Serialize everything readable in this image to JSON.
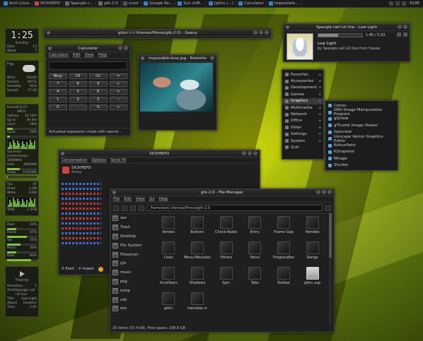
{
  "taskbar": {
    "items": [
      {
        "label": "Arch Linux",
        "color": "#3c7fc2"
      },
      {
        "label": "SICKHEPO",
        "color": "#c04545"
      },
      {
        "label": "Spangle c...",
        "color": "#6a6a6a"
      },
      {
        "label": "gtk-2.0",
        "color": "#6a6a6a"
      },
      {
        "label": "urxvt",
        "color": "#555"
      },
      {
        "label": "Google Re...",
        "color": "#3c7fc2"
      },
      {
        "label": "Sun xVB...",
        "color": "#3c7fc2"
      },
      {
        "label": "[gtkrc (...)",
        "color": "#3c7fc2"
      },
      {
        "label": "Calculator",
        "color": "#3c7fc2"
      },
      {
        "label": "impossible...",
        "color": "#3c7fc2"
      }
    ],
    "clock": "0135"
  },
  "sidebar": {
    "clock": {
      "time": "1:25",
      "day": "Sunday"
    },
    "date_rows": [
      [
        "Date",
        "13"
      ],
      [
        "Week",
        "7"
      ]
    ],
    "weather": {
      "label": "Fog",
      "rows": [
        [
          "Wind",
          "5km/h"
        ],
        [
          "Sunrise",
          "06:51"
        ],
        [
          "Humidity",
          "92%"
        ],
        [
          "Sunset",
          "17:43"
        ]
      ]
    },
    "system": {
      "rows": [
        [
          "Kernel",
          "2.6.27-ARCH"
        ],
        [
          "Uptime",
          "1h 10m"
        ],
        [
          "Up to",
          "0h 0m"
        ]
      ],
      "cpu1_label": "Cpu1",
      "cpu1_value": "18%",
      "cpu1_fill": 0.18,
      "cpu2_label": "Cpu2",
      "cpu2_value": "10%",
      "cpu2_fill": 0.1,
      "governor_label": "Governor",
      "governor_value": "performance 1600MHz",
      "ram_label": "Ram",
      "ram_value": "400/960",
      "ram_fill": 0.42,
      "swap_label": "Swap",
      "swap_value": "1%/1486",
      "swap_fill": 0.01
    },
    "disk": {
      "rows": [
        [
          "Tps",
          "47"
        ],
        [
          "Read",
          "1.2M"
        ],
        [
          "Write",
          "0.6M"
        ]
      ],
      "total_label": "Total",
      "total_value": "1.2GB"
    },
    "storage": {
      "rows": [
        [
          "Root",
          "32%"
        ],
        [
          "Home",
          "67%"
        ],
        [
          "Var",
          "45%"
        ],
        [
          "Music",
          "30%"
        ],
        [
          "Data",
          "80%"
        ]
      ],
      "fills": [
        0.32,
        0.67,
        0.45,
        0.3,
        0.8
      ]
    },
    "player_widget": {
      "status": "Playing",
      "rows": [
        [
          "Kainotoxa",
          "1"
        ],
        [
          "Artist",
          "Spangle call Lili line"
        ],
        [
          "Title",
          "Low Light"
        ],
        [
          "Album",
          "Isolation"
        ],
        [
          "Time",
          "1:45"
        ]
      ]
    }
  },
  "calculator": {
    "title": "Calculator",
    "menu": [
      "Calculator",
      "Edit",
      "View",
      "Help"
    ],
    "display": "",
    "keys": [
      "Bksp",
      "CE",
      "Clr",
      "=",
      "7",
      "8",
      "9",
      "÷",
      "4",
      "5",
      "6",
      "×",
      "1",
      "2",
      "3",
      "−",
      "0",
      ".",
      "%",
      "+"
    ],
    "status": "Activated expression mode with operat..."
  },
  "image_viewer": {
    "title": "impossible-love.jpg - Ristretto"
  },
  "editor_window": {
    "title": "gtkrc (~/.themes/Pirevo/gtk-2.0) - Geany"
  },
  "player": {
    "title": "Spangle call Lili line - Low Light",
    "track": "Low Light",
    "artist": "by Spangle call Lili line from Hanae",
    "time": "1:45 / 5:10"
  },
  "app_menu": {
    "items": [
      {
        "label": "Favorites",
        "sub": true
      },
      {
        "label": "Accessories",
        "sub": true
      },
      {
        "label": "Development",
        "sub": true
      },
      {
        "label": "Games",
        "sub": true
      },
      {
        "label": "Graphics",
        "sub": true,
        "selected": true
      },
      {
        "label": "Multimedia",
        "sub": true
      },
      {
        "label": "Network",
        "sub": true
      },
      {
        "label": "Office",
        "sub": true
      },
      {
        "label": "Other",
        "sub": true
      },
      {
        "label": "Settings",
        "sub": true
      },
      {
        "label": "System",
        "sub": true
      },
      {
        "label": "Quit",
        "sub": false
      }
    ],
    "graphics_submenu": [
      "Comix",
      "GNU Image Manipulation Program",
      "gQview",
      "gThumb Image Viewer",
      "Gpicview",
      "Inkscape Vector Graphics Editor",
      "KolourPaint",
      "KSnapshot",
      "Mirage",
      "Shutter"
    ]
  },
  "chat": {
    "title": "SICKHEPO",
    "menu": [
      "Conversation",
      "Options",
      "Send To"
    ],
    "contact": "SICKHEPO",
    "contact_status": "Away",
    "log_colors": [
      "#3d6fd1",
      "#3d6fd1",
      "#c43232",
      "#3d6fd1",
      "#c43232",
      "#c43232",
      "#3d6fd1",
      "#c43232",
      "#3d6fd1",
      "#c43232",
      "#3d6fd1",
      "#c43232",
      "#3d6fd1"
    ],
    "font_label": "Font",
    "insert_label": "Insert"
  },
  "file_manager": {
    "title": "gtk-2.0 - File Manager",
    "menu": [
      "File",
      "Edit",
      "View",
      "Go",
      "Help"
    ],
    "path": "/home/sen/.themes/Pirevo/gtk-2.0",
    "places": [
      "sen",
      "Trash",
      "Desktop",
      "File System",
      "Fileserver",
      "gfx",
      "music",
      "pkg",
      "temp",
      "usb",
      "win"
    ],
    "files": [
      {
        "name": "Arrows",
        "doc": false
      },
      {
        "name": "Buttons",
        "doc": false
      },
      {
        "name": "Check-Radio",
        "doc": false
      },
      {
        "name": "Entry",
        "doc": false
      },
      {
        "name": "Frame-Gap",
        "doc": false
      },
      {
        "name": "Handles",
        "doc": false
      },
      {
        "name": "Lines",
        "doc": false
      },
      {
        "name": "Menu-Menubar",
        "doc": false
      },
      {
        "name": "Others",
        "doc": false
      },
      {
        "name": "Panel",
        "doc": false
      },
      {
        "name": "ProgressBar",
        "doc": false
      },
      {
        "name": "Range",
        "doc": false
      },
      {
        "name": "Scrollbars",
        "doc": false
      },
      {
        "name": "Shadows",
        "doc": false
      },
      {
        "name": "Spin",
        "doc": false
      },
      {
        "name": "Tabs",
        "doc": false
      },
      {
        "name": "Toolbar",
        "doc": false
      },
      {
        "name": "gtkrc.sup",
        "doc": true
      },
      {
        "name": "gtkrc",
        "doc": false
      },
      {
        "name": "menubar.rc",
        "doc": false
      }
    ],
    "status": "20 items (37.4 kB), Free space: 208.8 GB"
  }
}
